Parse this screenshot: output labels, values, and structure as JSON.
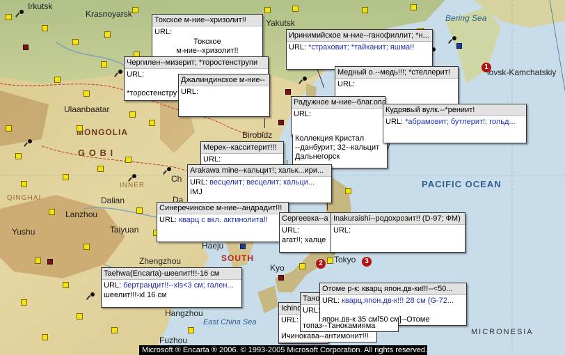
{
  "map": {
    "place_labels": [
      {
        "id": "irkutsk",
        "text": "Irkutsk"
      },
      {
        "id": "krasnoyarsk",
        "text": "Krasnoyarsk"
      },
      {
        "id": "yakutsk",
        "text": "Yakutsk"
      },
      {
        "id": "bering",
        "text": "Bering Sea"
      },
      {
        "id": "kamchatsky",
        "text": "lovsk-Kamchatskiy"
      },
      {
        "id": "ulaanbaatar",
        "text": "Ulaanbaatar"
      },
      {
        "id": "mongolia",
        "text": "MONGOLIA"
      },
      {
        "id": "gobi",
        "text": "G O B I"
      },
      {
        "id": "birobidzhan",
        "text": "Birobidz"
      },
      {
        "id": "pacific",
        "text": "PACIFIC OCEAN"
      },
      {
        "id": "qinghai",
        "text": "QINGHAI"
      },
      {
        "id": "lanzhou",
        "text": "Lanzhou"
      },
      {
        "id": "yushu",
        "text": "Yushu"
      },
      {
        "id": "taiyuan",
        "text": "Taiyuan"
      },
      {
        "id": "haeju",
        "text": "Haeju"
      },
      {
        "id": "south",
        "text": "SOUTH"
      },
      {
        "id": "tokyo",
        "text": "Tokyo"
      },
      {
        "id": "zhengzhou",
        "text": "Zhengzhou"
      },
      {
        "id": "hangzhou",
        "text": "Hangzhou"
      },
      {
        "id": "eastchina",
        "text": "East China Sea"
      },
      {
        "id": "fuzhou",
        "text": "Fuzhou"
      },
      {
        "id": "micronesia",
        "text": "MICRONESIA"
      },
      {
        "id": "dalian",
        "text": "Dalian"
      },
      {
        "id": "beijing_c",
        "text": "Ch"
      },
      {
        "id": "datong",
        "text": "Da"
      },
      {
        "id": "inner",
        "text": "INNER"
      },
      {
        "id": "kyo",
        "text": "Kyo"
      }
    ],
    "number_markers": [
      "1",
      "2",
      "3"
    ]
  },
  "popups": [
    {
      "id": "p1",
      "title": "Токское м-ние--хризолит!!",
      "url_label": "URL:",
      "url_value": "",
      "body": [
        "Токское",
        "м-ние--хризолит!!"
      ],
      "centered": true
    },
    {
      "id": "p2",
      "title": "Иринимийское м-ние--ганофиллит; *н...",
      "url_label": "URL:",
      "url_value": "*страховит; *тайканит; яшма!!",
      "body": []
    },
    {
      "id": "p3",
      "title": "Чергилен--мизерит; *торостенструпи",
      "url_label": "URL:",
      "url_value": "",
      "body": [
        "Чергиле",
        "*торостенстру"
      ],
      "centered": true
    },
    {
      "id": "p4",
      "title": "Джалиндинское м-ние--",
      "url_label": "URL:",
      "url_value": "",
      "body": []
    },
    {
      "id": "p5",
      "title": "Медный о.--медь!!!; *стеллерит!",
      "url_label": "URL:",
      "url_value": "",
      "body": []
    },
    {
      "id": "p6",
      "title": "Радужное м-ние--благ.опал!",
      "url_label": "URL:",
      "url_value": "",
      "body": []
    },
    {
      "id": "p7",
      "title": "Кудрявый вулк.--*рениит!",
      "url_label": "URL:",
      "url_value": "*абрамовит; бутлерит!; гольд...",
      "body": []
    },
    {
      "id": "p8",
      "title": "",
      "url_label": "",
      "url_value": "",
      "body": [
        "Коллекция Кристал",
        "--данбурит; 32--кальцит",
        "Дальнегорск"
      ]
    },
    {
      "id": "p9",
      "title": "Мерек--касситерит!!!",
      "url_label": "URL:",
      "url_value": "",
      "body": []
    },
    {
      "id": "p10",
      "title": "Arakawa mine--кальцит!; хальк...ири...",
      "url_label": "URL:",
      "url_value": "весцелит; весцелит; кальци...",
      "body": [
        "IMJ"
      ]
    },
    {
      "id": "p11",
      "title": "Синеречинское м-ние--андрадит!!!",
      "url_label": "URL:",
      "url_value": "кварц с вкл. актинолита!!",
      "body": []
    },
    {
      "id": "p12",
      "title": "Сергеевка--а",
      "url_label": "URL:",
      "url_value": "",
      "body": [
        "агат!!; халце"
      ]
    },
    {
      "id": "p13",
      "title": "Inakuraishi--родохрозит!! (D-97; ФМ)",
      "url_label": "URL:",
      "url_value": "",
      "body": []
    },
    {
      "id": "p14",
      "title": "Taehwa(Encarta)-шеелит!!!-16 см",
      "url_label": "URL:",
      "url_value": "бертрандит!!--xls<3 см; гален...",
      "body": [
        "шеелит!!!-xl 16 см"
      ]
    },
    {
      "id": "p15",
      "title": "Отоме р-к: кварц япон.дв-ки!!!--<50...",
      "url_label": "URL:",
      "url_value": "кварц,япон.дв-к!!! 28 см (G-72...",
      "body": [
        "",
        "япон.дв-к 35 см[50 см]--Отоме"
      ]
    },
    {
      "id": "p16",
      "title": "Тано",
      "url_label": "URL:",
      "url_value": "",
      "body": [
        "топаз--Танокамияма"
      ]
    },
    {
      "id": "p17",
      "title": "Ichino",
      "url_label": "URL:",
      "url_value": "",
      "body": [
        "Ичинокава--антимонит!!!"
      ]
    }
  ],
  "copyright": "Microsoft ® Encarta ® 2006. © 1993-2005 Microsoft Corporation. All rights reserved.",
  "colors": {
    "sea": "#c9dcea",
    "land": "#e8dcae",
    "mountain": "#c8a36a",
    "popup_title": "#e2e2e2",
    "url_value": "#1c2fb0",
    "marker": "#f2e20e"
  }
}
